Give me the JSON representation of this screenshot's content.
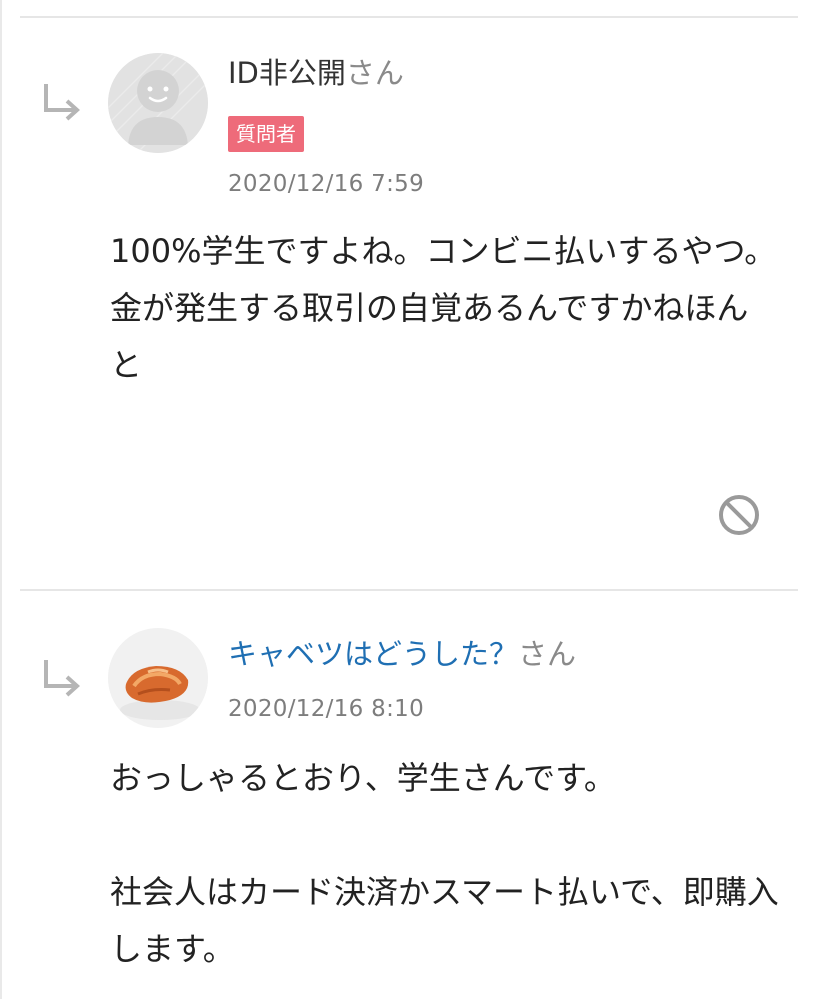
{
  "colors": {
    "badge_bg": "#ee6b7a",
    "link_author": "#1f6fb3",
    "meta_gray": "#7d7d7d",
    "divider": "#e6e6e6"
  },
  "answers": [
    {
      "author_name": "ID非公開",
      "author_suffix": "さん",
      "badge": "質問者",
      "date": "2020/12/16 7:59",
      "avatar_icon": "default-user-avatar",
      "body_lines": [
        "100%学生ですよね。コンビニ払いするやつ。",
        "金が発生する取引の自覚あるんですかねほんと"
      ],
      "action_icon": "block-icon"
    },
    {
      "author_name": "キャベツはどうした？",
      "author_suffix": "さん",
      "date": "2020/12/16 8:10",
      "avatar_icon": "food-photo-avatar",
      "body_lines": [
        "おっしゃるとおり、学生さんです。",
        "",
        "社会人はカード決済かスマート払いで、即購入します。"
      ]
    }
  ]
}
